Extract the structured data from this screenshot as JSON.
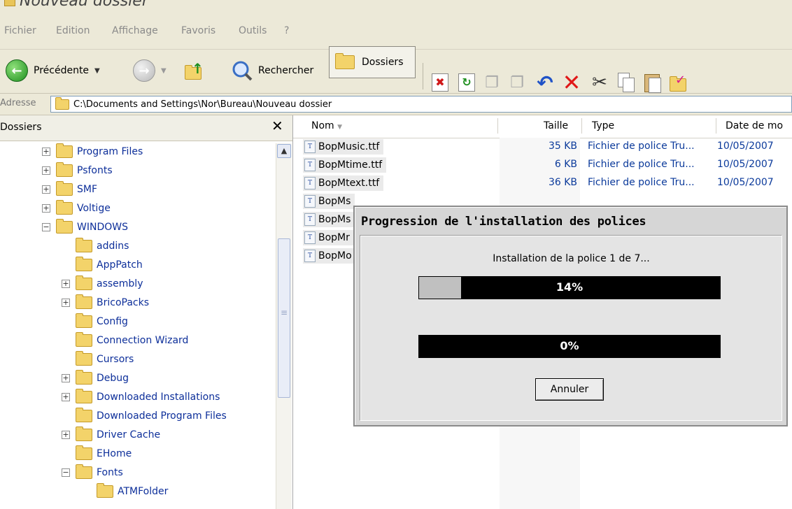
{
  "window": {
    "title": "Nouveau dossier"
  },
  "menu": [
    "Fichier",
    "Edition",
    "Affichage",
    "Favoris",
    "Outils",
    "?"
  ],
  "toolbar": {
    "back_label": "Précédente",
    "search_label": "Rechercher",
    "folders_label": "Dossiers",
    "icons": [
      "delete-icon",
      "refresh-icon",
      "move-to-icon",
      "copy-to-icon",
      "undo-icon",
      "delete-x-icon",
      "cut-icon",
      "copy-icon",
      "paste-icon",
      "properties-icon"
    ]
  },
  "address": {
    "label": "Adresse",
    "path": "C:\\Documents and Settings\\Nor\\Bureau\\Nouveau dossier"
  },
  "folders_pane": {
    "title": "Dossiers",
    "items": [
      {
        "label": "Program Files",
        "expander": "+",
        "level": 0
      },
      {
        "label": "Psfonts",
        "expander": "+",
        "level": 0
      },
      {
        "label": "SMF",
        "expander": "+",
        "level": 0
      },
      {
        "label": "Voltige",
        "expander": "+",
        "level": 0
      },
      {
        "label": "WINDOWS",
        "expander": "−",
        "level": 0
      },
      {
        "label": "addins",
        "expander": "",
        "level": 1
      },
      {
        "label": "AppPatch",
        "expander": "",
        "level": 1
      },
      {
        "label": "assembly",
        "expander": "+",
        "level": 1
      },
      {
        "label": "BricoPacks",
        "expander": "+",
        "level": 1
      },
      {
        "label": "Config",
        "expander": "",
        "level": 1
      },
      {
        "label": "Connection Wizard",
        "expander": "",
        "level": 1
      },
      {
        "label": "Cursors",
        "expander": "",
        "level": 1
      },
      {
        "label": "Debug",
        "expander": "+",
        "level": 1
      },
      {
        "label": "Downloaded Installations",
        "expander": "+",
        "level": 1
      },
      {
        "label": "Downloaded Program Files",
        "expander": "",
        "level": 1
      },
      {
        "label": "Driver Cache",
        "expander": "+",
        "level": 1
      },
      {
        "label": "EHome",
        "expander": "",
        "level": 1
      },
      {
        "label": "Fonts",
        "expander": "−",
        "level": 1
      },
      {
        "label": "ATMFolder",
        "expander": "",
        "level": 2
      }
    ]
  },
  "columns": {
    "name": "Nom",
    "size": "Taille",
    "type": "Type",
    "date": "Date de mo"
  },
  "files": [
    {
      "name": "BopMusic.ttf",
      "size": "35 KB",
      "type": "Fichier de police Tru...",
      "date": "10/05/2007"
    },
    {
      "name": "BopMtime.ttf",
      "size": "6 KB",
      "type": "Fichier de police Tru...",
      "date": "10/05/2007"
    },
    {
      "name": "BopMtext.ttf",
      "size": "36 KB",
      "type": "Fichier de police Tru...",
      "date": "10/05/2007"
    },
    {
      "name": "BopMs",
      "size": "",
      "type": "",
      "date": ""
    },
    {
      "name": "BopMs",
      "size": "",
      "type": "",
      "date": ""
    },
    {
      "name": "BopMr",
      "size": "",
      "type": "",
      "date": ""
    },
    {
      "name": "BopMo",
      "size": "",
      "type": "",
      "date": ""
    }
  ],
  "dialog": {
    "title": "Progression de l'installation des polices",
    "message": "Installation de la police 1 de 7...",
    "progress1": {
      "value": 14,
      "label": "14%"
    },
    "progress2": {
      "value": 0,
      "label": "0%"
    },
    "cancel_label": "Annuler"
  }
}
